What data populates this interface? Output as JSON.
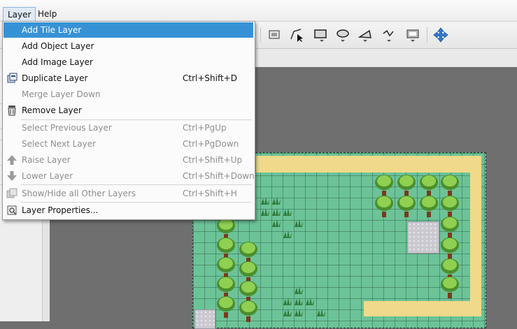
{
  "menubar": {
    "items": [
      "Layer",
      "Help"
    ]
  },
  "layer_menu": {
    "items": [
      {
        "label": "Add Tile Layer",
        "shortcut": "",
        "enabled": true,
        "highlighted": true,
        "icon": ""
      },
      {
        "label": "Add Object Layer",
        "shortcut": "",
        "enabled": true,
        "icon": ""
      },
      {
        "label": "Add Image Layer",
        "shortcut": "",
        "enabled": true,
        "icon": ""
      },
      {
        "label": "Duplicate Layer",
        "shortcut": "Ctrl+Shift+D",
        "enabled": true,
        "icon": "duplicate-icon"
      },
      {
        "label": "Merge Layer Down",
        "shortcut": "",
        "enabled": false,
        "icon": ""
      },
      {
        "label": "Remove Layer",
        "shortcut": "",
        "enabled": true,
        "icon": "trash-icon"
      },
      {
        "label": "Select Previous Layer",
        "shortcut": "Ctrl+PgUp",
        "enabled": false,
        "icon": ""
      },
      {
        "label": "Select Next Layer",
        "shortcut": "Ctrl+PgDown",
        "enabled": false,
        "icon": ""
      },
      {
        "label": "Raise Layer",
        "shortcut": "Ctrl+Shift+Up",
        "enabled": false,
        "icon": "arrow-up-icon"
      },
      {
        "label": "Lower Layer",
        "shortcut": "Ctrl+Shift+Down",
        "enabled": false,
        "icon": "arrow-down-icon"
      },
      {
        "label": "Show/Hide all Other Layers",
        "shortcut": "Ctrl+Shift+H",
        "enabled": false,
        "icon": "layers-icon"
      },
      {
        "label": "Layer Properties...",
        "shortcut": "",
        "enabled": true,
        "icon": "properties-icon"
      }
    ]
  },
  "toolbar": {
    "tools": [
      "insert-image-tool-icon",
      "insert-polyline-tool-icon",
      "insert-rectangle-tool-icon",
      "insert-ellipse-tool-icon",
      "insert-polygon-tool-icon",
      "insert-polyline2-tool-icon",
      "insert-tile-tool-icon",
      "move-tool-icon"
    ]
  },
  "colors": {
    "highlight": "#3792d5",
    "grass": "#6cc398",
    "sand": "#f0d98a",
    "canvas": "#6f6f6f"
  }
}
